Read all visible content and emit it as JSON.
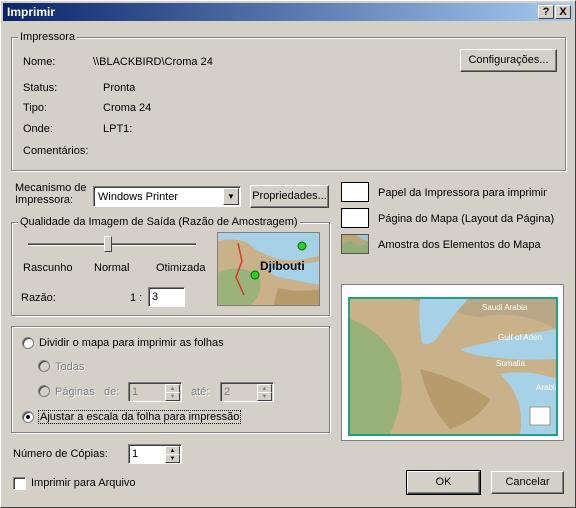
{
  "window": {
    "title": "Imprimir",
    "help_btn": "?",
    "close_btn": "X"
  },
  "printer": {
    "group_label": "Impressora",
    "name_label": "Nome:",
    "name_value": "\\\\BLACKBIRD\\Croma 24",
    "status_label": "Status:",
    "status_value": "Pronta",
    "type_label": "Tipo:",
    "type_value": "Croma 24",
    "where_label": "Onde:",
    "where_value": "LPT1:",
    "comments_label": "Comentários:",
    "settings_btn": "Configurações..."
  },
  "engine": {
    "label_line1": "Mecanismo de",
    "label_line2": "Impressora:",
    "selected": "Windows Printer",
    "properties_btn": "Propriedades..."
  },
  "legend": {
    "paper": "Papel da Impressora para imprimir",
    "page": "Página do Mapa (Layout da Página)",
    "sample": "Amostra dos Elementos do Mapa"
  },
  "quality": {
    "group_label": "Qualidade da Imagem de Saída (Razão de Amostragem)",
    "draft": "Rascunho",
    "normal": "Normal",
    "optimized": "Otimizada",
    "ratio_label": "Razão:",
    "ratio_prefix": "1 :",
    "ratio_value": "3",
    "slider_level": 0.5,
    "thumb_label": "Djibouti"
  },
  "tiling": {
    "tile_option": "Dividir o mapa para imprimir as folhas",
    "all_option": "Todas",
    "pages_option": "Páginas",
    "from_label": "de:",
    "from_value": "1",
    "to_label": "até:",
    "to_value": "2",
    "fit_option": "Ajustar a escala da folha para impressão"
  },
  "preview": {
    "labels": [
      "Saudi Arabia",
      "Gulf of Aden",
      "Somalia",
      "Arabia"
    ]
  },
  "copies": {
    "label": "Número de Cópias:",
    "value": "1"
  },
  "print_to_file": "Imprimir para Arquivo",
  "ok_btn": "OK",
  "cancel_btn": "Cancelar"
}
